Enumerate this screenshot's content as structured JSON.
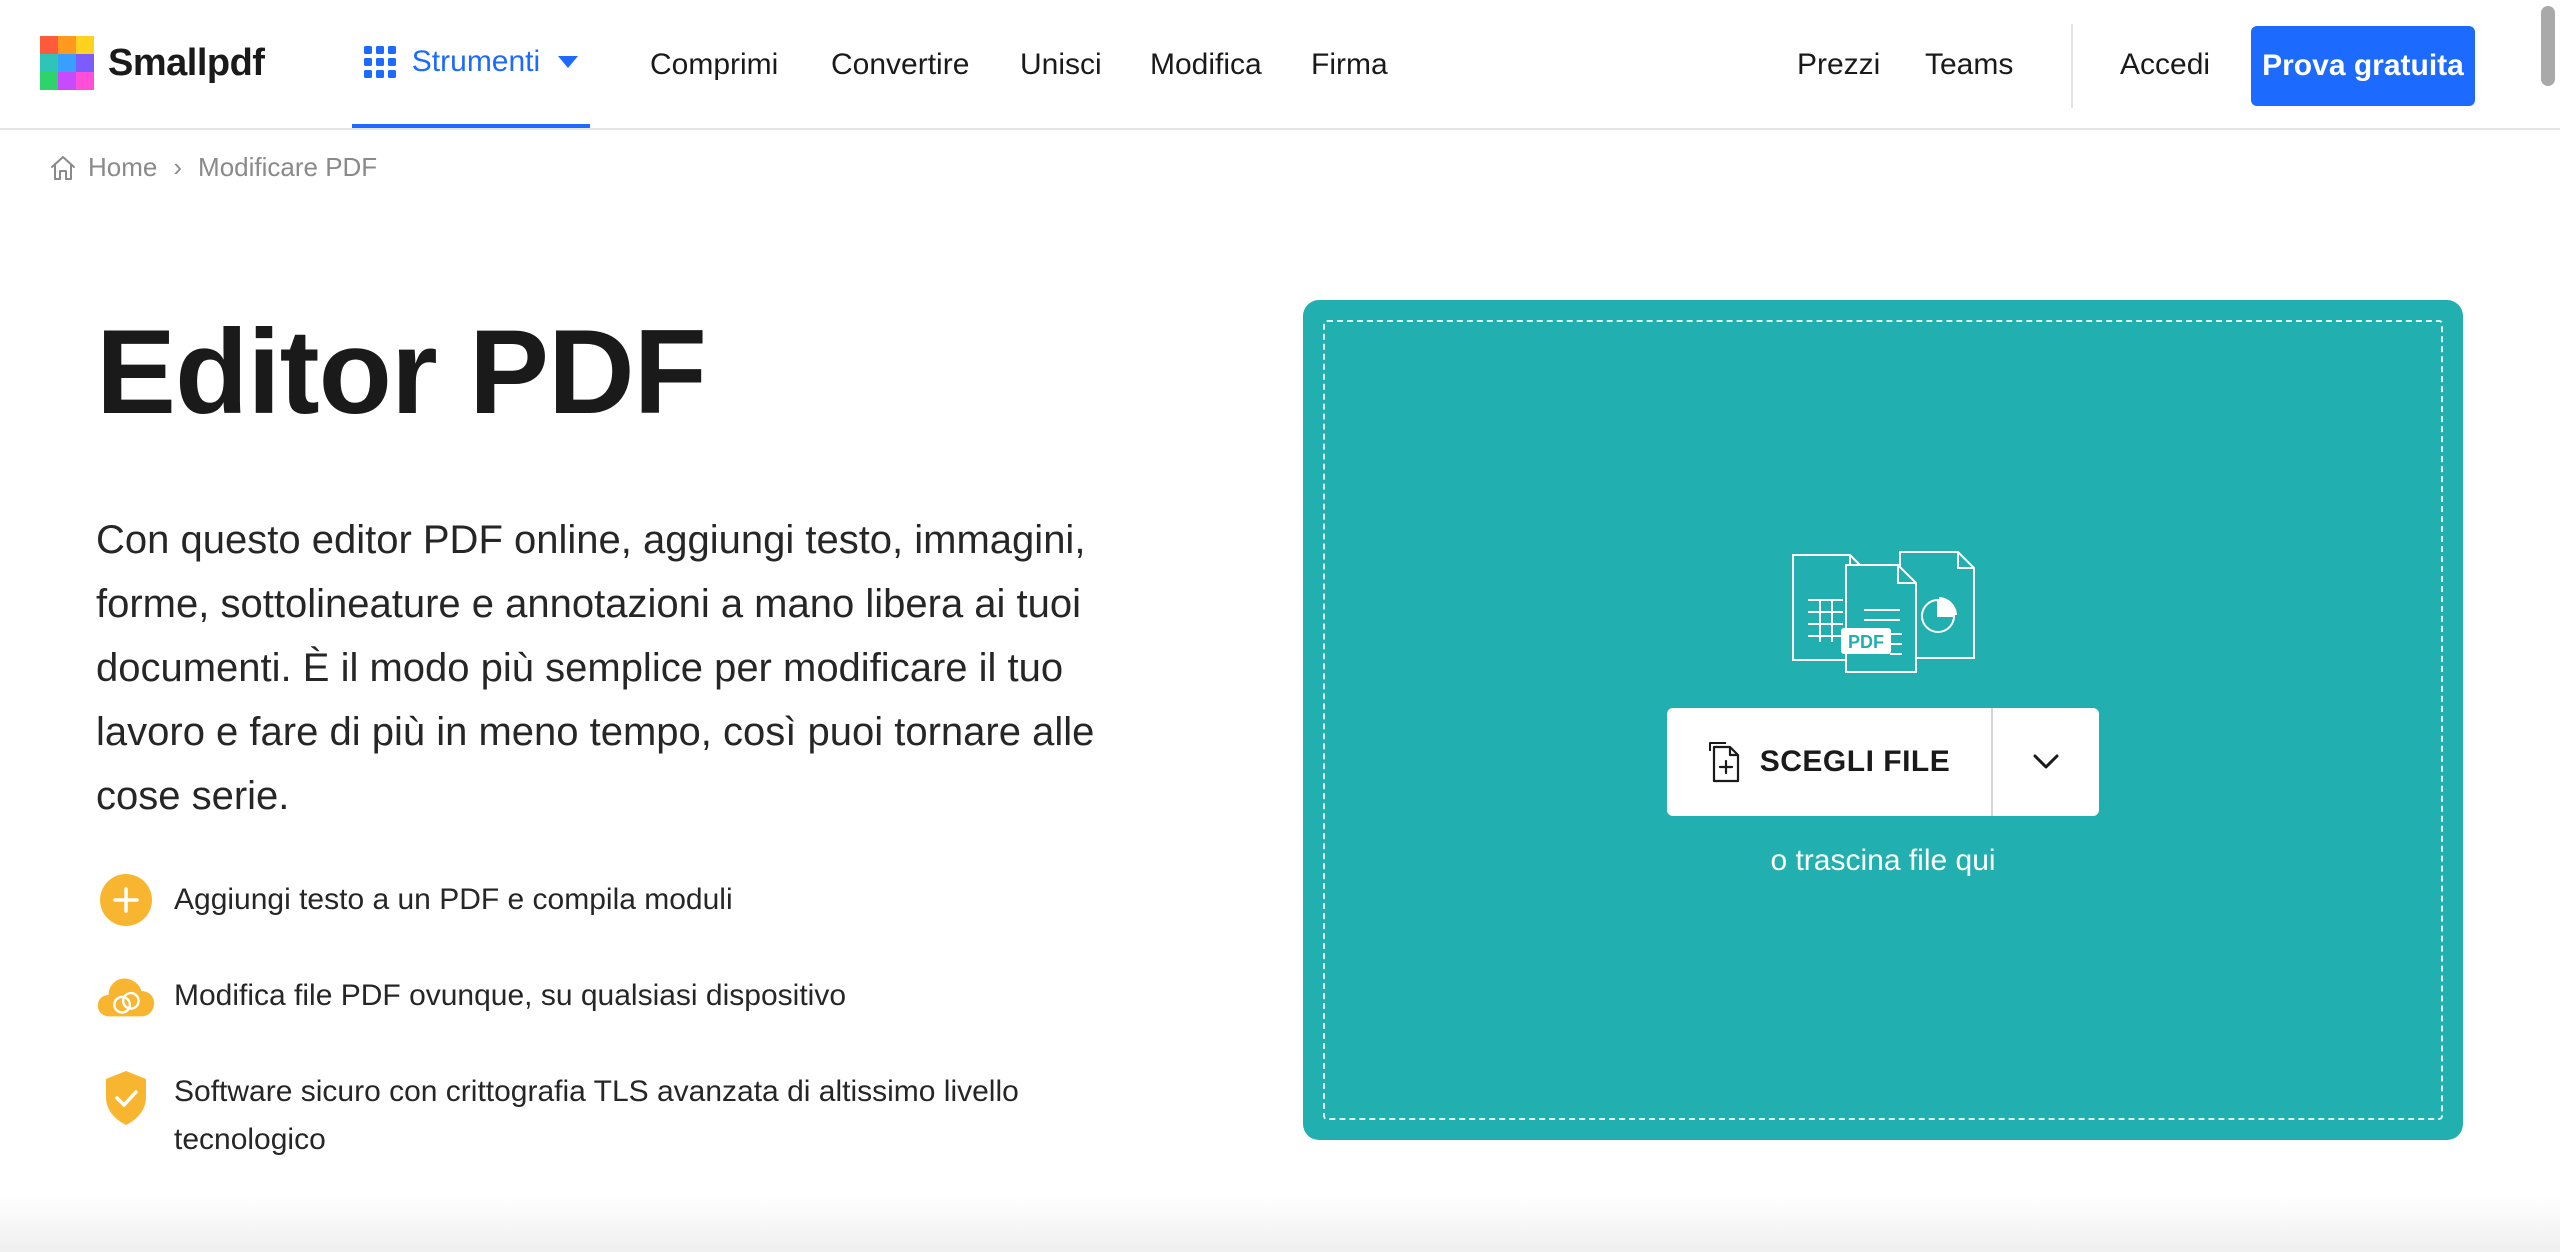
{
  "app": {
    "brand": "Smallpdf"
  },
  "colors": {
    "accent": "#1d6aff",
    "dropzone": "#22afb0",
    "feature_icon": "#f8b630"
  },
  "nav": {
    "tools_label": "Strumenti",
    "links": [
      "Comprimi",
      "Convertire",
      "Unisci",
      "Modifica",
      "Firma"
    ],
    "right_links": [
      "Prezzi",
      "Teams"
    ],
    "login": "Accedi",
    "cta": "Prova gratuita"
  },
  "breadcrumb": {
    "home": "Home",
    "separator": "›",
    "current": "Modificare PDF"
  },
  "hero": {
    "title": "Editor PDF",
    "description": "Con questo editor PDF online, aggiungi testo, immagini, forme, sottolineature e annotazioni a mano libera ai tuoi documenti. È il modo più semplice per modificare il tuo lavoro e fare di più in meno tempo, così puoi tornare alle cose serie."
  },
  "features": [
    {
      "icon": "plus-circle-icon",
      "text": "Aggiungi testo a un PDF e compila moduli"
    },
    {
      "icon": "cloud-sync-icon",
      "text": "Modifica file PDF ovunque, su qualsiasi dispositivo"
    },
    {
      "icon": "shield-check-icon",
      "text": "Software sicuro con crittografia TLS avanzata di altissimo livello tecnologico"
    }
  ],
  "dropzone": {
    "illustration_label": "PDF",
    "choose_label": "SCEGLI FILE",
    "drag_text": "o trascina file qui"
  }
}
